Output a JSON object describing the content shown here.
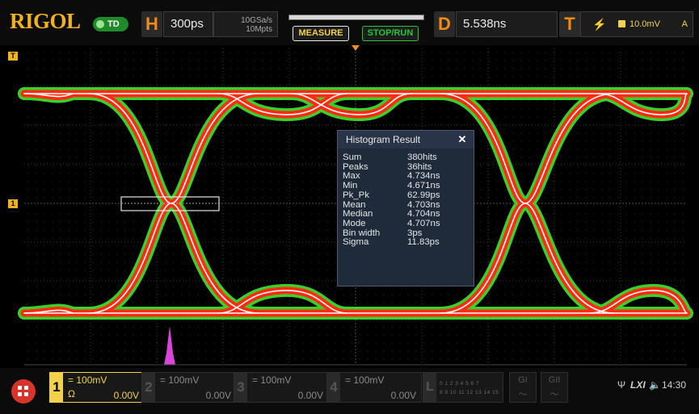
{
  "header": {
    "logo": "RIGOL",
    "run_mode": "TD",
    "horizontal": {
      "letter": "H",
      "timebase": "300ps",
      "sample_rate": "10GSa/s",
      "memory_depth": "10Mpts"
    },
    "measure_label": "MEASURE",
    "stop_run_label": "STOP/RUN",
    "delay": {
      "letter": "D",
      "value": "5.538ns"
    },
    "trigger": {
      "letter": "T",
      "level": "10.0mV",
      "mode": "A",
      "edge_icon": "rising-edge-icon",
      "source": "1"
    },
    "memory_progress": 1.0
  },
  "screen": {
    "left_markers": [
      "T",
      "1"
    ]
  },
  "histogram": {
    "title": "Histogram Result",
    "close_label": "✕",
    "rows": [
      {
        "label": "Sum",
        "value": "380hits"
      },
      {
        "label": "Peaks",
        "value": "36hits"
      },
      {
        "label": "Max",
        "value": "4.734ns"
      },
      {
        "label": "Min",
        "value": "4.671ns"
      },
      {
        "label": "Pk_Pk",
        "value": "62.99ps"
      },
      {
        "label": "Mean",
        "value": "4.703ns"
      },
      {
        "label": "Median",
        "value": "4.704ns"
      },
      {
        "label": "Mode",
        "value": "4.707ns"
      },
      {
        "label": "Bin width",
        "value": "3ps"
      },
      {
        "label": "Sigma",
        "value": "11.83ps"
      }
    ]
  },
  "channels": [
    {
      "num": "1",
      "scale": "= 100mV",
      "coupling": "Ω",
      "offset": "0.00V",
      "active": true
    },
    {
      "num": "2",
      "scale": "= 100mV",
      "offset": "0.00V",
      "active": false
    },
    {
      "num": "3",
      "scale": "= 100mV",
      "offset": "0.00V",
      "active": false
    },
    {
      "num": "4",
      "scale": "= 100mV",
      "offset": "0.00V",
      "active": false
    }
  ],
  "logic": {
    "letter": "L",
    "digits_top": "0 1 2 3  4 5 6 7",
    "digits_bottom": "8 9 10 11 12 13 14 15"
  },
  "decoders": [
    "GI",
    "GII"
  ],
  "status": {
    "lxi": "LXI",
    "time": "14:30"
  },
  "colors": {
    "accent": "#f2b31a",
    "channel1": "#f2d24a",
    "eye_red": "#ff2a12",
    "eye_green": "#39d12b",
    "histogram": "#d845d8"
  }
}
